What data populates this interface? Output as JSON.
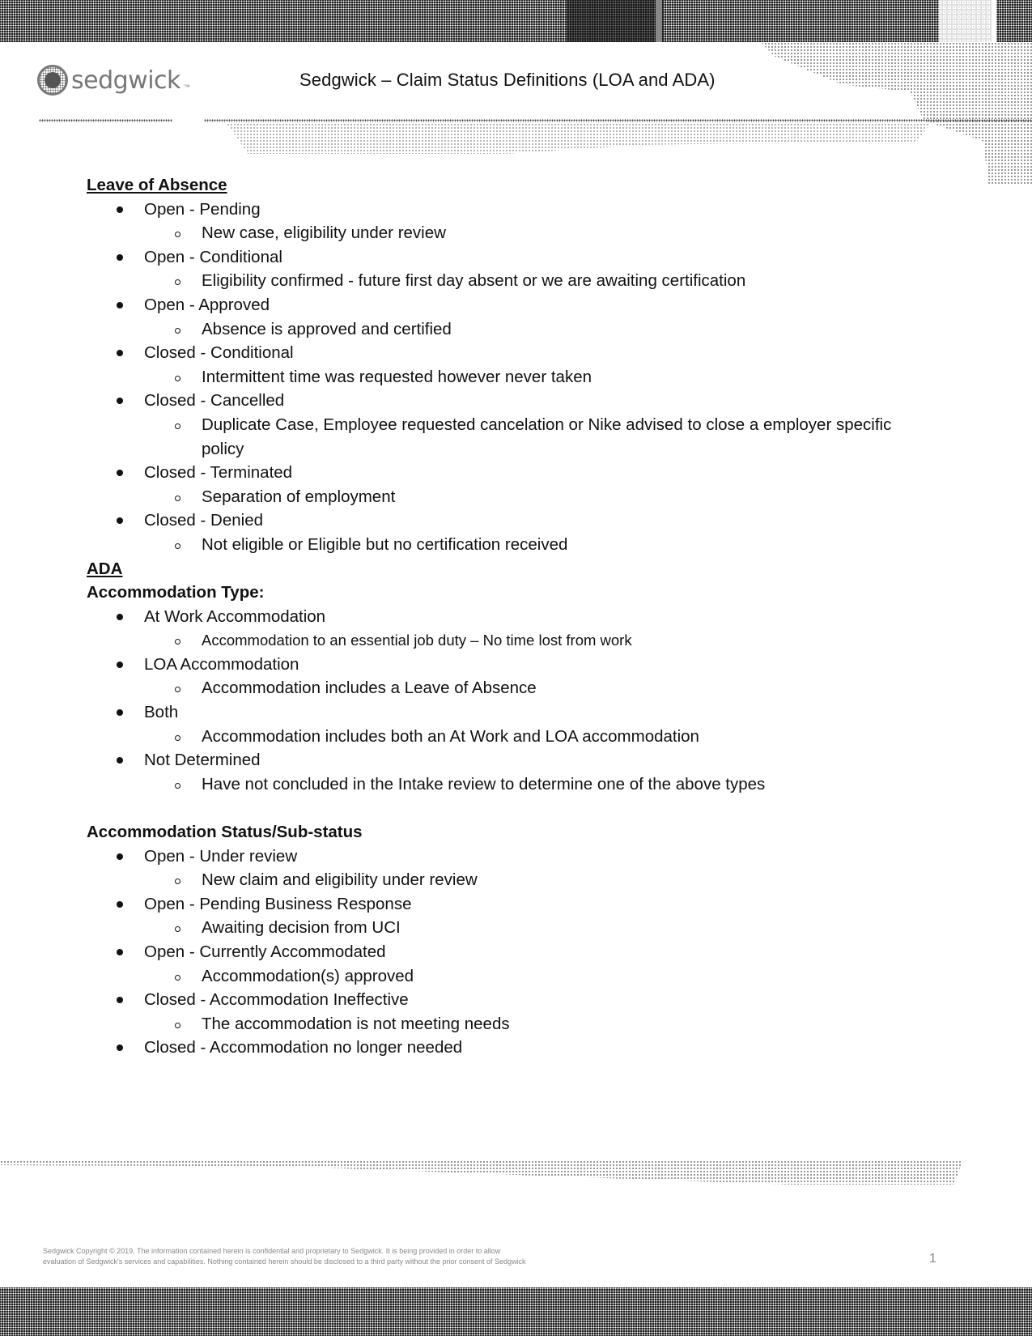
{
  "header": {
    "logo_text": "sedgwick",
    "logo_mark_icon": "sedgwick-globe-logo",
    "title": "Sedgwick – Claim Status Definitions (LOA and ADA)"
  },
  "sections": {
    "loa": {
      "heading": "Leave of Absence",
      "items": [
        {
          "status": "Open - Pending",
          "definitions": [
            "New case, eligibility under review"
          ]
        },
        {
          "status": "Open - Conditional",
          "definitions": [
            "Eligibility confirmed - future first day absent or we are awaiting certification"
          ]
        },
        {
          "status": "Open - Approved",
          "definitions": [
            "Absence is approved and certified"
          ]
        },
        {
          "status": "Closed - Conditional",
          "definitions": [
            "Intermittent time was requested however never taken"
          ]
        },
        {
          "status": "Closed - Cancelled",
          "definitions": [
            "Duplicate Case, Employee requested cancelation or Nike advised to close a employer specific policy"
          ]
        },
        {
          "status": "Closed - Terminated",
          "definitions": [
            "Separation of employment"
          ]
        },
        {
          "status": "Closed - Denied",
          "definitions": [
            "Not eligible or Eligible but no certification received"
          ]
        }
      ]
    },
    "ada": {
      "heading": "ADA",
      "type_heading": "Accommodation Type:",
      "types": [
        {
          "status": "At Work Accommodation",
          "definitions": [
            "Accommodation to an essential job duty – No time lost from work"
          ]
        },
        {
          "status": "LOA Accommodation",
          "definitions": [
            "Accommodation includes a Leave of Absence"
          ]
        },
        {
          "status": "Both",
          "definitions": [
            "Accommodation includes both an At Work and LOA accommodation"
          ]
        },
        {
          "status": "Not Determined",
          "definitions": [
            "Have not concluded in the Intake review to determine one of the above types"
          ]
        }
      ],
      "status_heading": "Accommodation Status/Sub-status",
      "statuses": [
        {
          "status": "Open - Under review",
          "definitions": [
            "New claim and eligibility under review"
          ]
        },
        {
          "status": "Open - Pending Business Response",
          "definitions": [
            "Awaiting decision from UCI"
          ]
        },
        {
          "status": "Open - Currently Accommodated",
          "definitions": [
            "Accommodation(s) approved"
          ]
        },
        {
          "status": "Closed - Accommodation Ineffective",
          "definitions": [
            "The accommodation is not meeting needs"
          ]
        },
        {
          "status": "Closed - Accommodation no longer needed",
          "definitions": []
        }
      ]
    }
  },
  "footer": {
    "copyright_line1": "Sedgwick Copyright © 2019. The information contained herein is confidential and proprietary to Sedgwick. It is being provided in order to allow",
    "copyright_line2": "evaluation of Sedgwick's services and capabilities. Nothing contained herein should be disclosed to a third party without the prior consent of Sedgwick",
    "page_number": "1"
  }
}
